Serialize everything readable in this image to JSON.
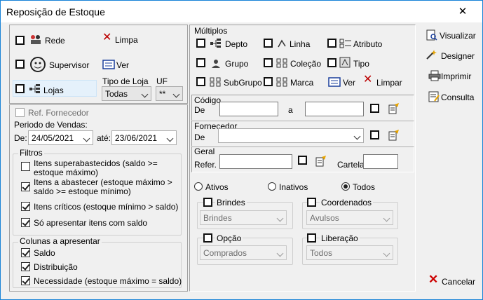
{
  "window": {
    "title": "Reposição de Estoque",
    "close_glyph": "✕"
  },
  "left": {
    "rede": "Rede",
    "limpa": "Limpa",
    "supervisor": "Supervisor",
    "ver": "Ver",
    "lojas": "Lojas",
    "tipo_loja_label": "Tipo de Loja",
    "tipo_loja_value": "Todas",
    "uf_label": "UF",
    "uf_value": "**",
    "ref_fornecedor": "Ref. Fornecedor",
    "periodo_label": "Periodo de Vendas:",
    "de": "De:",
    "de_value": "24/05/2021",
    "ate": "até:",
    "ate_value": "23/06/2021",
    "filtros_title": "Filtros",
    "filtros": [
      {
        "label": "Itens superabastecidos (saldo >= estoque máximo)",
        "checked": false
      },
      {
        "label": "Itens a abastecer (estoque máximo > saldo >= estoque mínimo)",
        "checked": true
      },
      {
        "label": "Itens críticos (estoque mínimo > saldo)",
        "checked": true
      },
      {
        "label": "Só apresentar itens com saldo",
        "checked": true
      }
    ],
    "colunas_title": "Colunas a apresentar",
    "colunas": [
      {
        "label": "Saldo",
        "checked": true
      },
      {
        "label": "Distribuição",
        "checked": true
      },
      {
        "label": "Necessidade (estoque máximo = saldo)",
        "checked": true
      }
    ]
  },
  "multiplos": {
    "title": "Múltiplos",
    "items": [
      "Depto",
      "Linha",
      "Atributo",
      "Grupo",
      "Coleção",
      "Tipo",
      "SubGrupo",
      "Marca",
      "Ver",
      "Limpar"
    ]
  },
  "codigo": {
    "title": "Código",
    "de": "De",
    "a": "a"
  },
  "fornecedor": {
    "title": "Fornecedor",
    "de": "De"
  },
  "geral": {
    "title": "Geral",
    "refer": "Refer.",
    "cartela": "Cartela"
  },
  "status": {
    "ativos": "Ativos",
    "inativos": "Inativos",
    "todos": "Todos"
  },
  "groups": {
    "brindes": "Brindes",
    "brindes_value": "Brindes",
    "coordenados": "Coordenados",
    "coordenados_value": "Avulsos",
    "opcao": "Opção",
    "opcao_value": "Comprados",
    "liberacao": "Liberação",
    "liberacao_value": "Todos"
  },
  "actions": {
    "visualizar": "Visualizar",
    "designer": "Designer",
    "imprimir": "Imprimir",
    "consulta": "Consulta",
    "cancelar": "Cancelar"
  }
}
